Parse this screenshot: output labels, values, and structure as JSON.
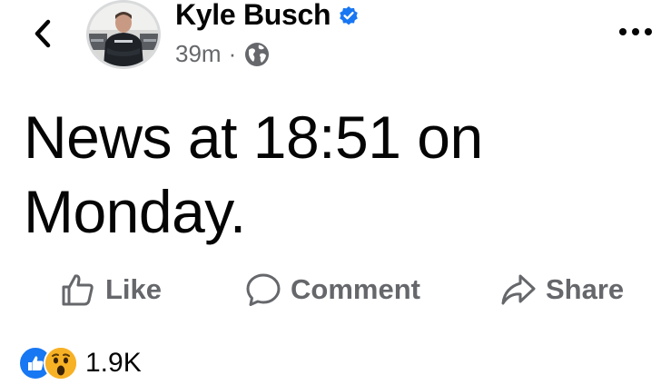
{
  "header": {
    "author_name": "Kyle Busch",
    "time_ago": "39m",
    "separator": "·",
    "audience_icon": "globe-icon",
    "verified": true,
    "back_icon": "chevron-left-icon",
    "more_icon": "more-horizontal-icon"
  },
  "post": {
    "text": "News at 18:51 on Monday."
  },
  "actions": {
    "like_label": "Like",
    "comment_label": "Comment",
    "share_label": "Share"
  },
  "reactions": {
    "types": [
      "like-reaction-icon",
      "wow-reaction-icon"
    ],
    "count": "1.9K"
  },
  "colors": {
    "text": "#050505",
    "secondary_text": "#65676b",
    "verified_blue": "#1877f2",
    "like_blue": "#1877f2",
    "wow_yellow": "#f7b125"
  }
}
